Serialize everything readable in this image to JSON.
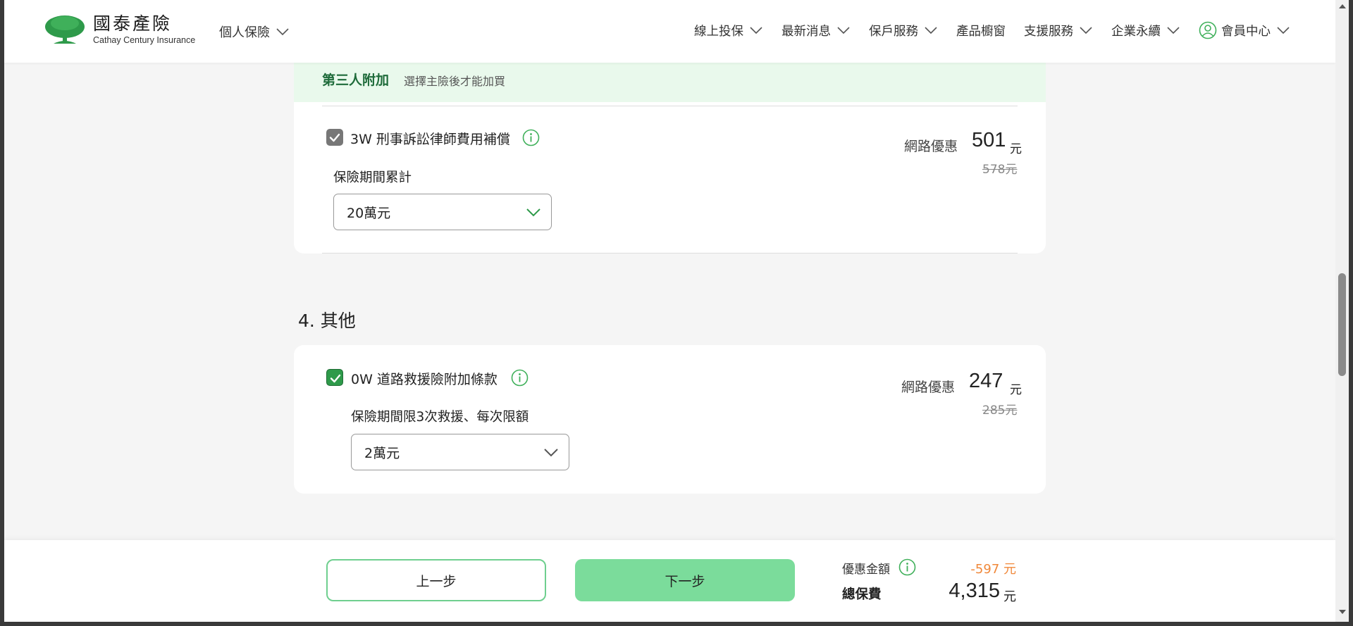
{
  "header": {
    "logo_cn": "國泰產險",
    "logo_en": "Cathay Century Insurance",
    "personal_menu": "個人保險",
    "nav": [
      {
        "label": "線上投保"
      },
      {
        "label": "最新消息"
      },
      {
        "label": "保戶服務"
      },
      {
        "label": "產品櫥窗"
      },
      {
        "label": "支援服務"
      },
      {
        "label": "企業永續"
      },
      {
        "label": "會員中心"
      }
    ]
  },
  "third_party": {
    "title": "第三人附加",
    "subtitle": "選擇主險後才能加買",
    "item": {
      "label": "3W 刑事訴訟律師費用補償",
      "checked": true,
      "sub_label": "保險期間累計",
      "select_value": "20萬元",
      "price_label": "網路優惠",
      "price": "501",
      "unit": "元",
      "old_price": "578元"
    }
  },
  "other": {
    "section_title": "4. 其他",
    "item": {
      "label": "0W 道路救援險附加條款",
      "checked": true,
      "sub_label": "保險期間限3次救援、每次限額",
      "select_value": "2萬元",
      "price_label": "網路優惠",
      "price": "247",
      "unit": "元",
      "old_price": "285元"
    }
  },
  "footer": {
    "prev_label": "上一步",
    "next_label": "下一步",
    "discount_label": "優惠金額",
    "discount_value": "-597 元",
    "total_label": "總保費",
    "total_value": "4,315",
    "total_unit": "元"
  },
  "colors": {
    "brand_green": "#2e9a4a",
    "accent_green": "#7bdc9b",
    "band_green": "#e9f9ec",
    "discount_orange": "#f0883a"
  },
  "icons": {
    "logo": "cathay-tree-logo",
    "chevron": "chevron-down-icon",
    "info": "info-icon",
    "user": "user-circle-icon",
    "check": "check-icon"
  }
}
